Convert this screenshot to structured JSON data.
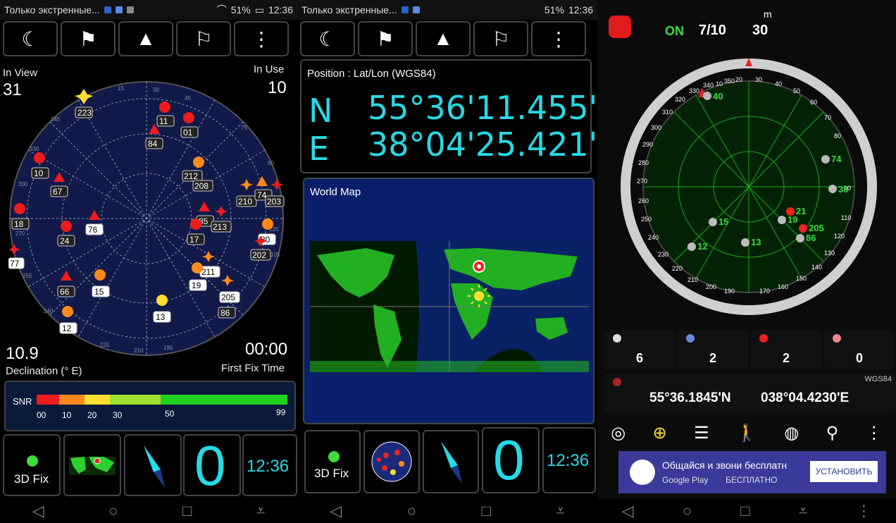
{
  "status": {
    "notification": "Только экстренные...",
    "notification2": "Только экстренные...",
    "battery": "51%",
    "time": "12:36"
  },
  "panel1": {
    "in_view_label": "In View",
    "in_view_value": "31",
    "in_use_label": "In Use",
    "in_use_value": "10",
    "declination_value": "10.9",
    "declination_label": "Declination (° E)",
    "first_fix_value": "00:00",
    "first_fix_label": "First Fix Time",
    "snr_label": "SNR",
    "snr_ticks": [
      "00",
      "10",
      "20",
      "30",
      "50",
      "99"
    ],
    "fix_label": "3D Fix",
    "speed": "0",
    "clock": "12:36",
    "sky_ticks": [
      "15",
      "30",
      "45",
      "75",
      "90",
      "345",
      "330",
      "300",
      "285",
      "270",
      "255",
      "240",
      "225",
      "210",
      "195",
      "120",
      "105"
    ],
    "satellites": [
      {
        "id": "223"
      },
      {
        "id": "11"
      },
      {
        "id": "01"
      },
      {
        "id": "84"
      },
      {
        "id": "212"
      },
      {
        "id": "208"
      },
      {
        "id": "10"
      },
      {
        "id": "67"
      },
      {
        "id": "210"
      },
      {
        "id": "74"
      },
      {
        "id": "203"
      },
      {
        "id": "18"
      },
      {
        "id": "76"
      },
      {
        "id": "85"
      },
      {
        "id": "213"
      },
      {
        "id": "24"
      },
      {
        "id": "17"
      },
      {
        "id": "80"
      },
      {
        "id": "202"
      },
      {
        "id": "77"
      },
      {
        "id": "211"
      },
      {
        "id": "19"
      },
      {
        "id": "66"
      },
      {
        "id": "15"
      },
      {
        "id": "205"
      },
      {
        "id": "13"
      },
      {
        "id": "86"
      },
      {
        "id": "12"
      }
    ]
  },
  "panel2": {
    "position_label": "Position : Lat/Lon (WGS84)",
    "lat_dir": "N",
    "lat_value": "55°36'11.455\"",
    "lon_dir": "E",
    "lon_value": "38°04'25.421\"",
    "map_label": "World Map",
    "fix_label": "3D Fix",
    "speed": "0",
    "clock": "12:36"
  },
  "panel3": {
    "status_on": "ON",
    "sats_used": "7/10",
    "accuracy": "30",
    "accuracy_unit": "m",
    "counts": [
      "6",
      "2",
      "2",
      "0"
    ],
    "datum": "WGS84",
    "lat": "55°36.1845'N",
    "lon": "038°04.4230'E",
    "compass_ticks": [
      "10",
      "20",
      "30",
      "40",
      "50",
      "60",
      "70",
      "80",
      "90",
      "110",
      "120",
      "130",
      "140",
      "150",
      "160",
      "170",
      "190",
      "200",
      "210",
      "220",
      "230",
      "240",
      "250",
      "260",
      "270",
      "280",
      "290",
      "300",
      "310",
      "320",
      "330",
      "340",
      "350"
    ],
    "sat_labels": [
      "40",
      "74",
      "30",
      "21",
      "19",
      "205",
      "86",
      "15",
      "12",
      "13"
    ],
    "ad_text": "Общайся и звони бесплатн",
    "ad_store": "Google Play",
    "ad_price": "БЕСПЛАТНО",
    "ad_button": "УСТАНОВИТЬ"
  },
  "colors": {
    "accent": "#27d9e6",
    "fix_green": "#3ddc3d",
    "on_green": "#3ddc3d",
    "sky_bg": "#121a4a"
  }
}
